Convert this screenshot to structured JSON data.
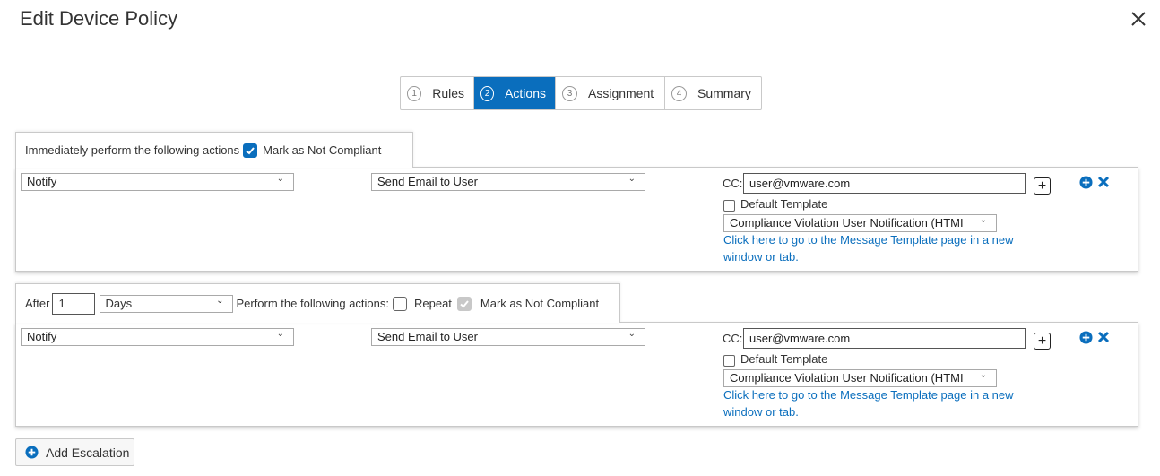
{
  "dialog": {
    "title": "Edit Device Policy"
  },
  "colors": {
    "accent": "#0a6ebd"
  },
  "stepper": {
    "steps": [
      {
        "num": "1",
        "label": "Rules",
        "active": false
      },
      {
        "num": "2",
        "label": "Actions",
        "active": true
      },
      {
        "num": "3",
        "label": "Assignment",
        "active": false
      },
      {
        "num": "4",
        "label": "Summary",
        "active": false
      }
    ]
  },
  "immediate": {
    "header_text": "Immediately perform the following actions",
    "mark_noncompliant_label": "Mark as Not Compliant",
    "mark_noncompliant_checked": true,
    "action": {
      "type_value": "Notify",
      "method_value": "Send Email to User",
      "cc_label": "CC:",
      "cc_value": "user@vmware.com",
      "default_template_label": "Default Template",
      "default_template_checked": false,
      "template_value": "Compliance Violation User Notification (HTMI",
      "template_link_line1": "Click here to go to the Message Template page in a new",
      "template_link_line2": "window or tab."
    }
  },
  "escalation": {
    "after_label": "After",
    "after_value": "1",
    "unit_value": "Days",
    "perform_label": "Perform the following actions:",
    "repeat_label": "Repeat",
    "repeat_checked": false,
    "mark_noncompliant_label": "Mark as Not Compliant",
    "mark_noncompliant_checked": true,
    "mark_noncompliant_disabled": true,
    "action": {
      "type_value": "Notify",
      "method_value": "Send Email to User",
      "cc_label": "CC:",
      "cc_value": "user@vmware.com",
      "default_template_label": "Default Template",
      "default_template_checked": false,
      "template_value": "Compliance Violation User Notification (HTMI",
      "template_link_line1": "Click here to go to the Message Template page in a new",
      "template_link_line2": "window or tab."
    }
  },
  "add_escalation_label": "Add Escalation",
  "icons": [
    "close-icon",
    "chevron-down-icon",
    "checkmark-icon",
    "plus-box-icon",
    "add-circle-icon",
    "delete-x-icon"
  ]
}
